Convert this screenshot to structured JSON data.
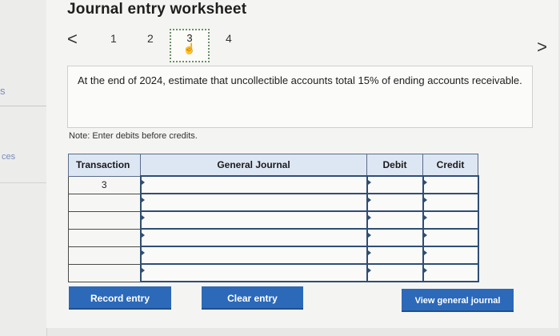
{
  "sidebar": {
    "fragment_top": "s",
    "fragment": "ces"
  },
  "title": "Journal entry worksheet",
  "pager": {
    "prev_glyph": "<",
    "next_glyph": ">",
    "pages": [
      "1",
      "2",
      "3",
      "4"
    ],
    "current_page": "3",
    "current_cursor_icon": "hand-pointer-icon"
  },
  "instruction": "At the end of 2024, estimate that uncollectible accounts total 15% of ending accounts receivable.",
  "note": "Note: Enter debits before credits.",
  "table": {
    "headers": {
      "transaction": "Transaction",
      "general_journal": "General Journal",
      "debit": "Debit",
      "credit": "Credit"
    },
    "rows": [
      {
        "transaction": "3",
        "general_journal": "",
        "debit": "",
        "credit": ""
      },
      {
        "transaction": "",
        "general_journal": "",
        "debit": "",
        "credit": ""
      },
      {
        "transaction": "",
        "general_journal": "",
        "debit": "",
        "credit": ""
      },
      {
        "transaction": "",
        "general_journal": "",
        "debit": "",
        "credit": ""
      },
      {
        "transaction": "",
        "general_journal": "",
        "debit": "",
        "credit": ""
      },
      {
        "transaction": "",
        "general_journal": "",
        "debit": "",
        "credit": ""
      }
    ]
  },
  "buttons": {
    "record": "Record entry",
    "clear": "Clear entry",
    "view": "View general journal"
  },
  "colors": {
    "button_blue": "#2c69b9",
    "header_fill": "#dde7f3",
    "input_border": "#2f4e74"
  }
}
